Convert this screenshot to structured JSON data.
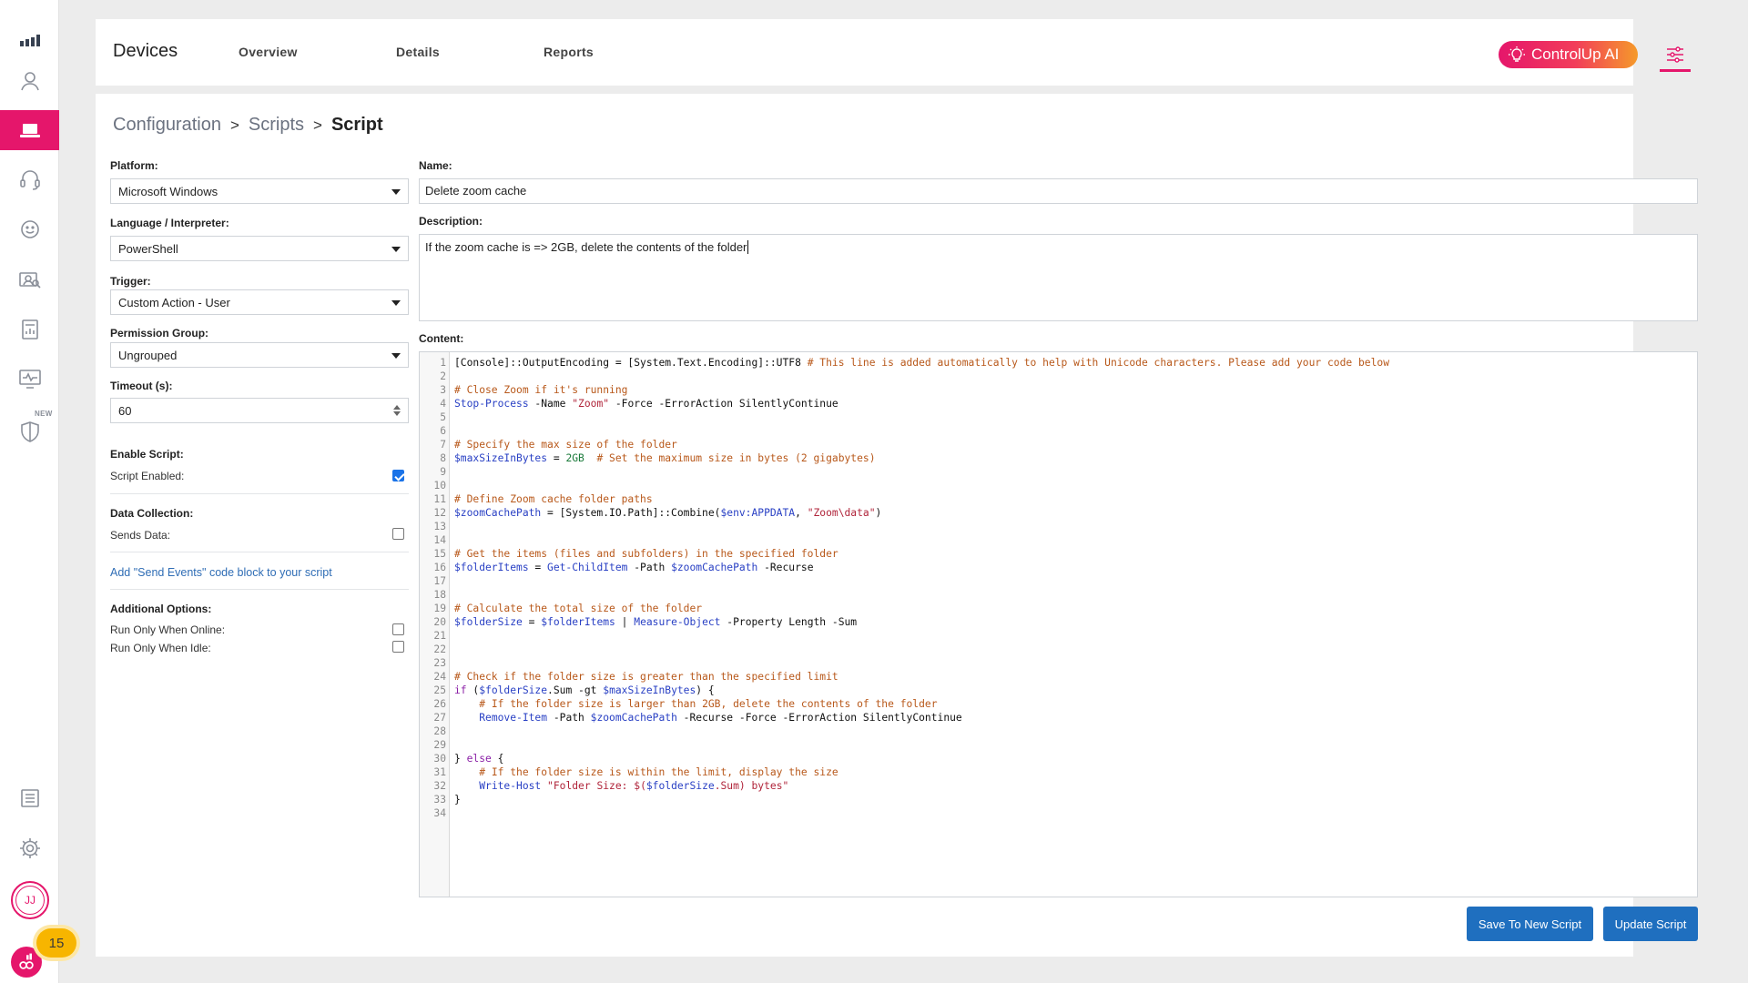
{
  "nav": {
    "items": [
      "signal-bars-icon",
      "user-icon",
      "laptop-icon",
      "headset-icon",
      "smiley-icon",
      "user-search-icon",
      "report-icon",
      "monitor-pulse-icon",
      "shield-icon",
      "list-icon",
      "gear-icon"
    ],
    "new_badge": "NEW",
    "avatar_initials": "JJ",
    "notification_count": "15"
  },
  "header": {
    "title": "Devices",
    "tabs": [
      "Overview",
      "Details",
      "Reports"
    ],
    "ai_button": "ControlUp AI"
  },
  "breadcrumb": {
    "items": [
      "Configuration",
      "Scripts"
    ],
    "separator": ">",
    "current": "Script"
  },
  "form": {
    "platform": {
      "label": "Platform:",
      "value": "Microsoft Windows"
    },
    "language": {
      "label": "Language / Interpreter:",
      "value": "PowerShell"
    },
    "trigger": {
      "label": "Trigger:",
      "value": "Custom Action - User"
    },
    "permission_group": {
      "label": "Permission Group:",
      "value": "Ungrouped"
    },
    "timeout": {
      "label": "Timeout (s):",
      "value": "60"
    },
    "enable_script": {
      "label": "Enable Script:",
      "option": "Script Enabled:",
      "checked": true
    },
    "data_collection": {
      "label": "Data Collection:",
      "option": "Sends Data:",
      "checked": false
    },
    "send_events_link": "Add \"Send Events\" code block to your script",
    "additional_options": {
      "label": "Additional Options:",
      "options": [
        {
          "label": "Run Only When Online:",
          "checked": false
        },
        {
          "label": "Run Only When Idle:",
          "checked": false
        }
      ]
    },
    "name": {
      "label": "Name:",
      "value": "Delete zoom cache"
    },
    "description": {
      "label": "Description:",
      "value": "If the zoom cache is => 2GB, delete the contents of the folder"
    },
    "content": {
      "label": "Content:"
    }
  },
  "code_lines": [
    [
      [
        "[Console]::OutputEncoding = [System.Text.Encoding]::UTF8 ",
        ""
      ],
      [
        "# This line is added automatically to help with Unicode characters. Please add your code below",
        "com"
      ]
    ],
    [],
    [
      [
        "# Close Zoom if it's running",
        "com"
      ]
    ],
    [
      [
        "Stop-Process",
        "cmd"
      ],
      [
        " -Name ",
        ""
      ],
      [
        "\"Zoom\"",
        "str"
      ],
      [
        " -Force -ErrorAction SilentlyContinue",
        ""
      ]
    ],
    [],
    [],
    [
      [
        "# Specify the max size of the folder",
        "com"
      ]
    ],
    [
      [
        "$maxSizeInBytes",
        "var"
      ],
      [
        " = ",
        ""
      ],
      [
        "2GB",
        "num"
      ],
      [
        "  ",
        ""
      ],
      [
        "# Set the maximum size in bytes (2 gigabytes)",
        "com"
      ]
    ],
    [],
    [],
    [
      [
        "# Define Zoom cache folder paths",
        "com"
      ]
    ],
    [
      [
        "$zoomCachePath",
        "var"
      ],
      [
        " = [System.IO.Path]::Combine(",
        ""
      ],
      [
        "$env:APPDATA",
        "var"
      ],
      [
        ", ",
        ""
      ],
      [
        "\"Zoom\\data\"",
        "str"
      ],
      [
        ")",
        ""
      ]
    ],
    [],
    [],
    [
      [
        "# Get the items (files and subfolders) in the specified folder",
        "com"
      ]
    ],
    [
      [
        "$folderItems",
        "var"
      ],
      [
        " = ",
        ""
      ],
      [
        "Get-ChildItem",
        "cmd"
      ],
      [
        " -Path ",
        ""
      ],
      [
        "$zoomCachePath",
        "var"
      ],
      [
        " -Recurse",
        ""
      ]
    ],
    [],
    [],
    [
      [
        "# Calculate the total size of the folder",
        "com"
      ]
    ],
    [
      [
        "$folderSize",
        "var"
      ],
      [
        " = ",
        ""
      ],
      [
        "$folderItems",
        "var"
      ],
      [
        " | ",
        ""
      ],
      [
        "Measure-Object",
        "cmd"
      ],
      [
        " -Property Length -Sum",
        ""
      ]
    ],
    [],
    [],
    [],
    [
      [
        "# Check if the folder size is greater than the specified limit",
        "com"
      ]
    ],
    [
      [
        "if",
        "kw"
      ],
      [
        " (",
        ""
      ],
      [
        "$folderSize",
        "var"
      ],
      [
        ".Sum -gt ",
        ""
      ],
      [
        "$maxSizeInBytes",
        "var"
      ],
      [
        ") {",
        ""
      ]
    ],
    [
      [
        "    ",
        ""
      ],
      [
        "# If the folder size is larger than 2GB, delete the contents of the folder",
        "com"
      ]
    ],
    [
      [
        "    ",
        ""
      ],
      [
        "Remove-Item",
        "cmd"
      ],
      [
        " -Path ",
        ""
      ],
      [
        "$zoomCachePath",
        "var"
      ],
      [
        " -Recurse -Force -ErrorAction SilentlyContinue",
        ""
      ]
    ],
    [],
    [],
    [
      [
        "} ",
        ""
      ],
      [
        "else",
        "kw"
      ],
      [
        " {",
        ""
      ]
    ],
    [
      [
        "    ",
        ""
      ],
      [
        "# If the folder size is within the limit, display the size",
        "com"
      ]
    ],
    [
      [
        "    ",
        ""
      ],
      [
        "Write-Host",
        "cmd"
      ],
      [
        " ",
        ""
      ],
      [
        "\"Folder Size: $(",
        "str"
      ],
      [
        "$folderSize",
        "var"
      ],
      [
        ".Sum) bytes\"",
        "str"
      ]
    ],
    [
      [
        "}",
        ""
      ]
    ],
    []
  ],
  "actions": {
    "save_new": "Save To New Script",
    "update": "Update Script"
  },
  "colors": {
    "accent": "#e5166b",
    "button": "#1f6fbf",
    "link": "#2f6db5"
  }
}
